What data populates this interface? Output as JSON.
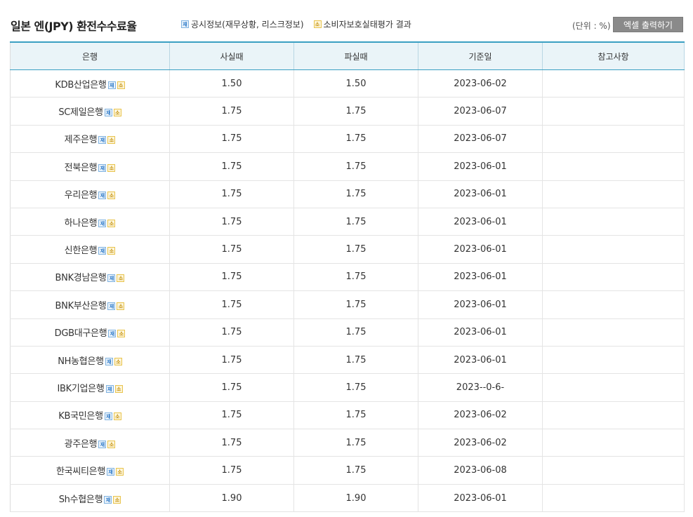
{
  "header": {
    "title": "일본 엔(JPY) 환전수수료율",
    "legend": [
      {
        "badge": "재",
        "label": "공시정보(재무상황, 리스크정보)"
      },
      {
        "badge": "소",
        "label": "소비자보호실태평가 결과"
      }
    ],
    "unit": "(단위 : %)",
    "excel_button": "엑셀 출력하기"
  },
  "table": {
    "columns": [
      "은행",
      "사실때",
      "파실때",
      "기준일",
      "참고사항"
    ],
    "rows": [
      {
        "bank": "KDB산업은행",
        "buy": "1.50",
        "sell": "1.50",
        "date": "2023-06-02",
        "note": ""
      },
      {
        "bank": "SC제일은행",
        "buy": "1.75",
        "sell": "1.75",
        "date": "2023-06-07",
        "note": ""
      },
      {
        "bank": "제주은행",
        "buy": "1.75",
        "sell": "1.75",
        "date": "2023-06-07",
        "note": ""
      },
      {
        "bank": "전북은행",
        "buy": "1.75",
        "sell": "1.75",
        "date": "2023-06-01",
        "note": ""
      },
      {
        "bank": "우리은행",
        "buy": "1.75",
        "sell": "1.75",
        "date": "2023-06-01",
        "note": ""
      },
      {
        "bank": "하나은행",
        "buy": "1.75",
        "sell": "1.75",
        "date": "2023-06-01",
        "note": ""
      },
      {
        "bank": "신한은행",
        "buy": "1.75",
        "sell": "1.75",
        "date": "2023-06-01",
        "note": ""
      },
      {
        "bank": "BNK경남은행",
        "buy": "1.75",
        "sell": "1.75",
        "date": "2023-06-01",
        "note": ""
      },
      {
        "bank": "BNK부산은행",
        "buy": "1.75",
        "sell": "1.75",
        "date": "2023-06-01",
        "note": ""
      },
      {
        "bank": "DGB대구은행",
        "buy": "1.75",
        "sell": "1.75",
        "date": "2023-06-01",
        "note": ""
      },
      {
        "bank": "NH농협은행",
        "buy": "1.75",
        "sell": "1.75",
        "date": "2023-06-01",
        "note": ""
      },
      {
        "bank": "IBK기업은행",
        "buy": "1.75",
        "sell": "1.75",
        "date": "2023--0-6-",
        "note": ""
      },
      {
        "bank": "KB국민은행",
        "buy": "1.75",
        "sell": "1.75",
        "date": "2023-06-02",
        "note": ""
      },
      {
        "bank": "광주은행",
        "buy": "1.75",
        "sell": "1.75",
        "date": "2023-06-02",
        "note": ""
      },
      {
        "bank": "한국씨티은행",
        "buy": "1.75",
        "sell": "1.75",
        "date": "2023-06-08",
        "note": ""
      },
      {
        "bank": "Sh수협은행",
        "buy": "1.90",
        "sell": "1.90",
        "date": "2023-06-01",
        "note": ""
      }
    ],
    "badge_jae": "재",
    "badge_so": "소"
  },
  "colors": {
    "header_accent": "#3a9fc2",
    "header_bg": "#eaf4f8",
    "button_bg": "#8a8a8a"
  }
}
